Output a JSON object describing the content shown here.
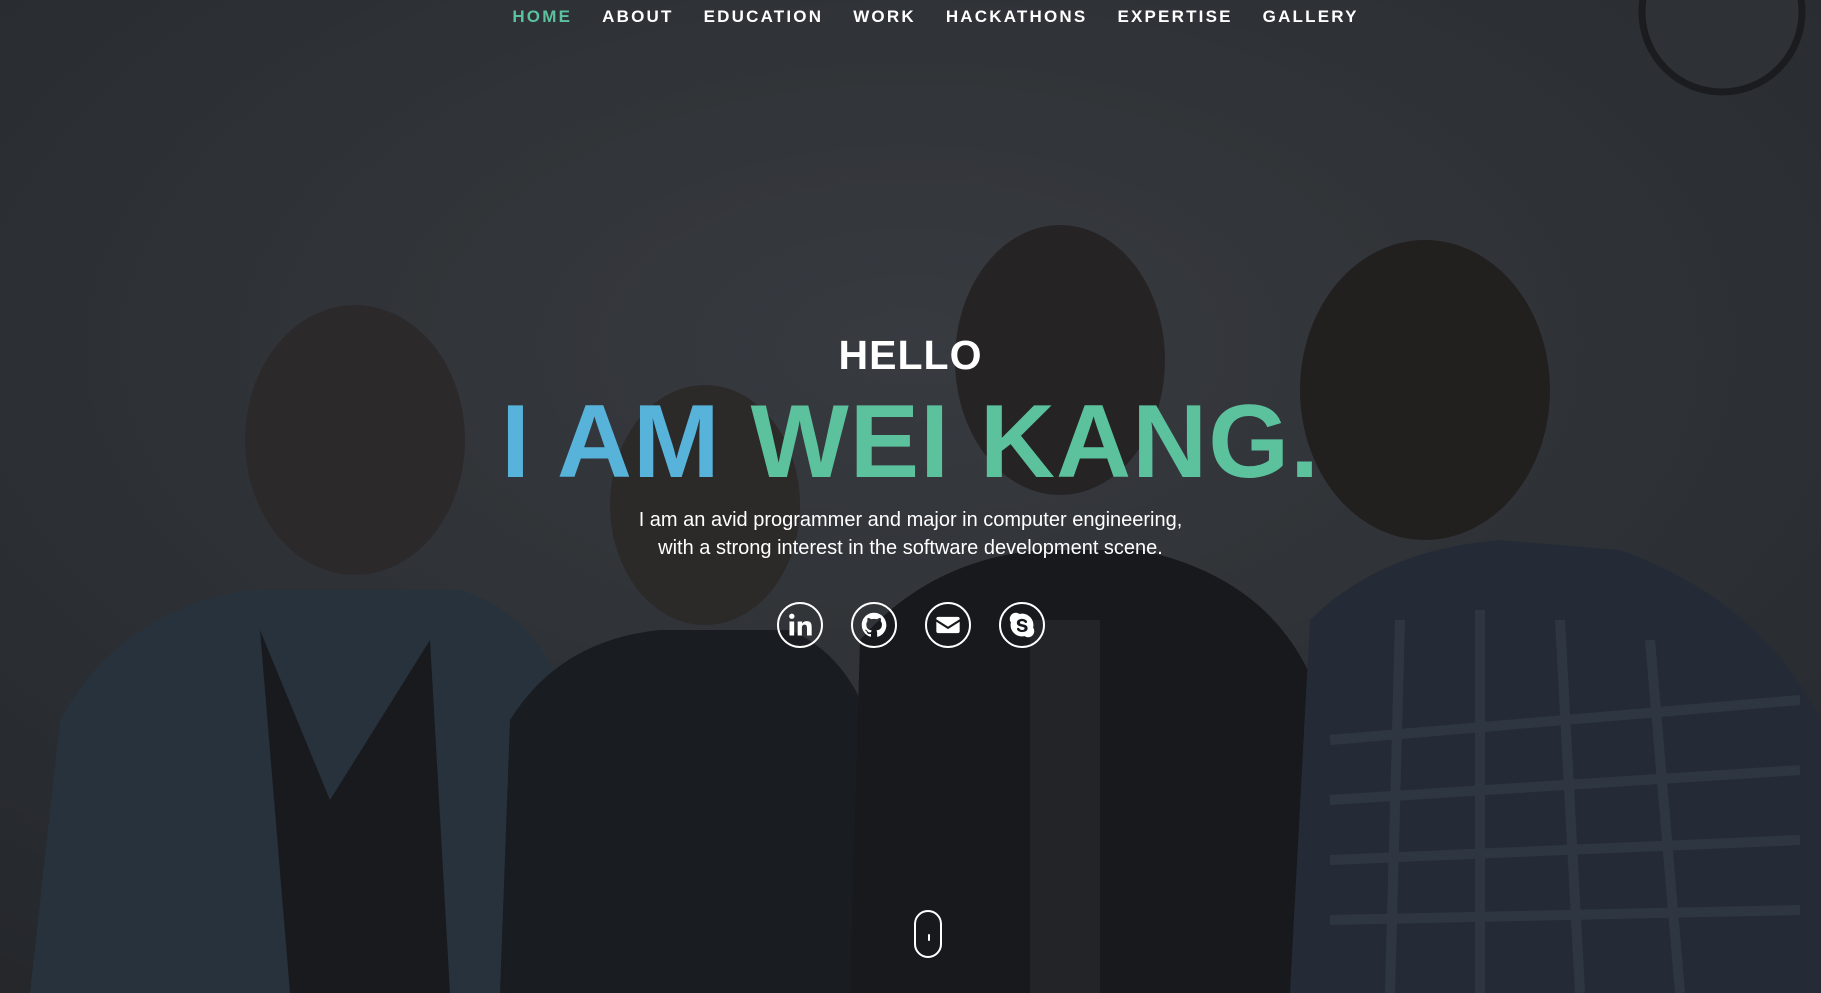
{
  "nav": {
    "items": [
      {
        "label": "HOME",
        "active": true
      },
      {
        "label": "ABOUT",
        "active": false
      },
      {
        "label": "EDUCATION",
        "active": false
      },
      {
        "label": "WORK",
        "active": false
      },
      {
        "label": "HACKATHONS",
        "active": false
      },
      {
        "label": "EXPERTISE",
        "active": false
      },
      {
        "label": "GALLERY",
        "active": false
      }
    ]
  },
  "hero": {
    "greeting": "HELLO",
    "headline_part1": "I AM",
    "headline_part2": "WEI KANG.",
    "description_line1": "I am an avid programmer and major in computer engineering,",
    "description_line2": "with a strong interest in the software development scene."
  },
  "socials": [
    {
      "icon": "linkedin-icon"
    },
    {
      "icon": "github-icon"
    },
    {
      "icon": "envelope-icon"
    },
    {
      "icon": "skype-icon"
    }
  ],
  "colors": {
    "accent_green": "#5cc29e",
    "accent_blue": "#57b3d9",
    "text": "#ffffff"
  }
}
